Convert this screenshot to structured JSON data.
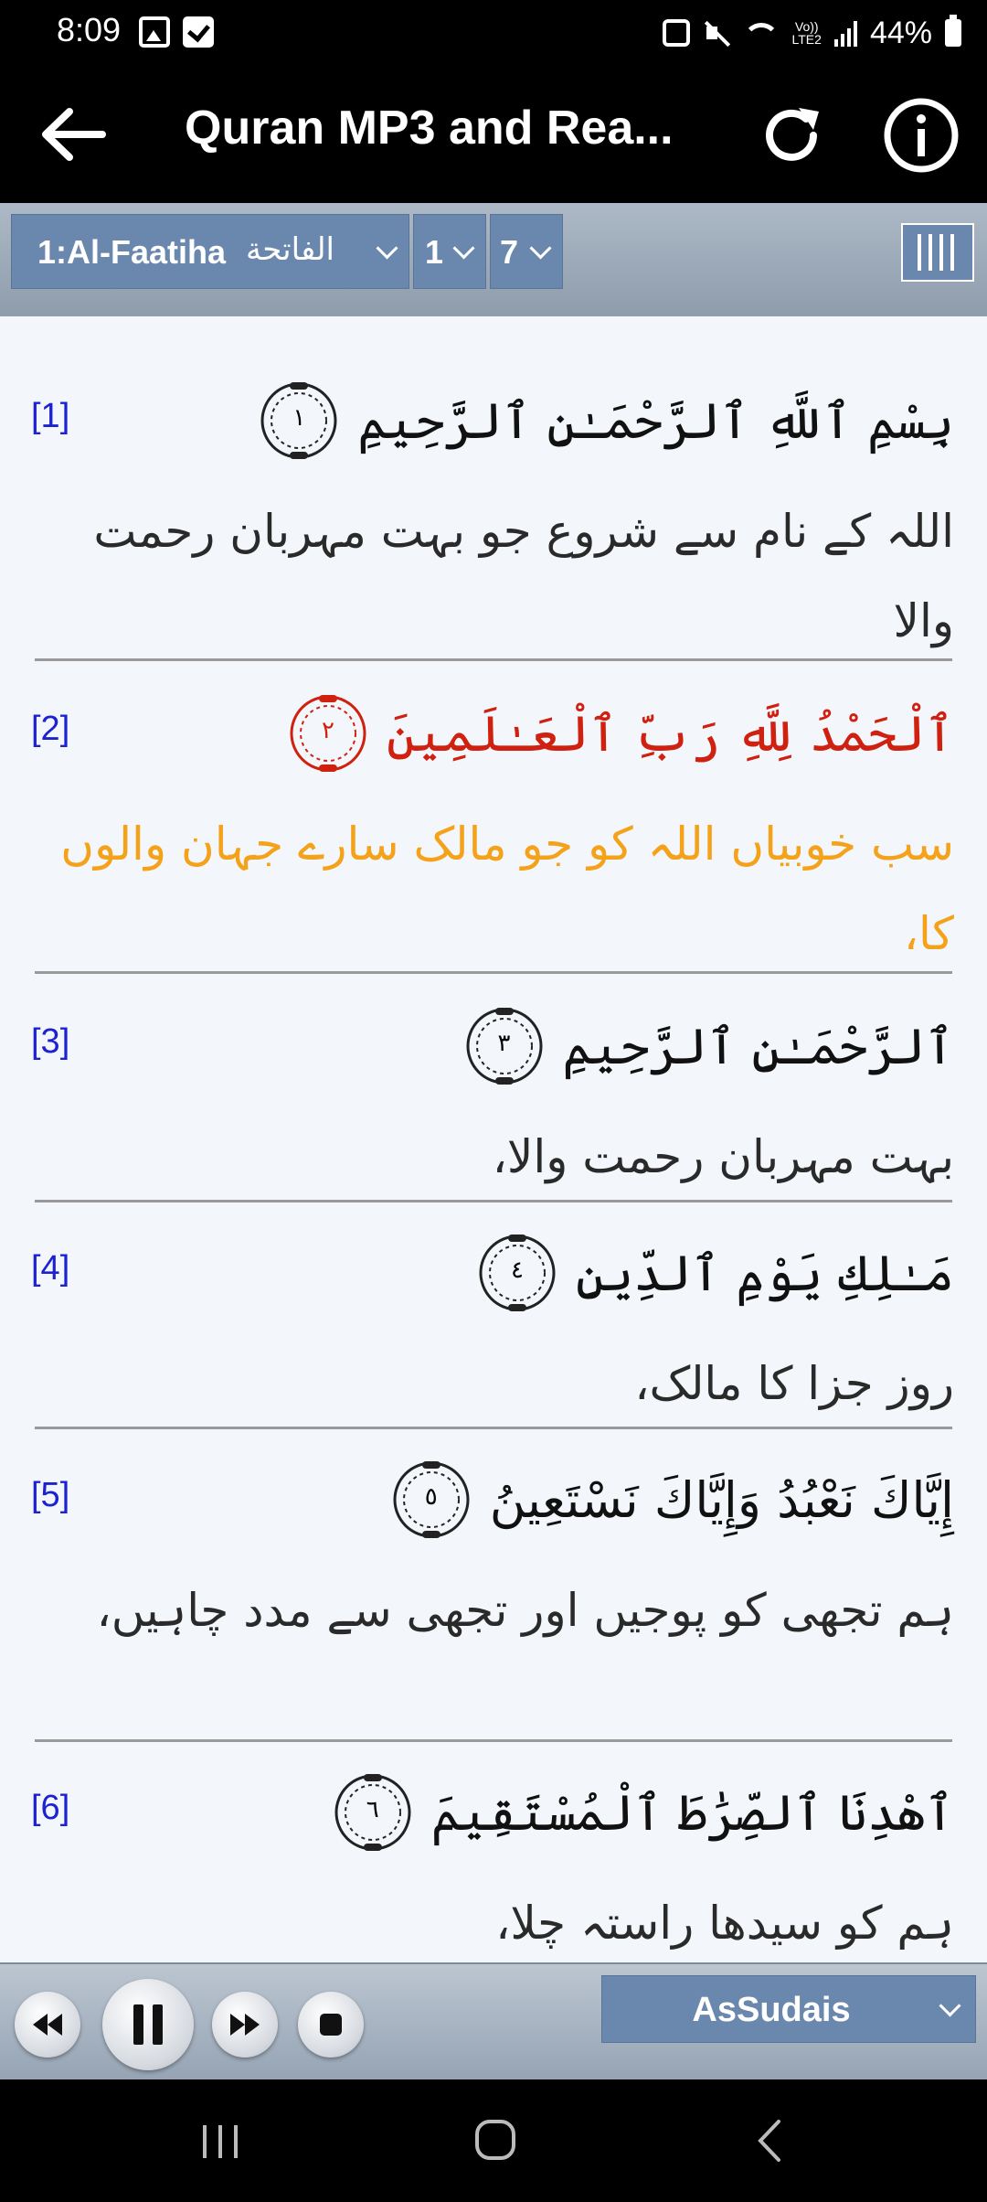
{
  "status_bar": {
    "time": "8:09",
    "volte_line1": "Vo))",
    "volte_line2": "LTE2",
    "battery_percent": "44%"
  },
  "app_bar": {
    "title": "Quran MP3 and Rea..."
  },
  "selectors": {
    "surah_latin": "1:Al-Faatiha",
    "surah_arabic": "الفاتحة",
    "ayah": "1",
    "count": "7"
  },
  "verses": [
    {
      "num": "[1]",
      "marker": "١",
      "arabic": "بِسْمِ ٱللَّهِ ٱلرَّحْمَـٰنِ ٱلرَّحِيمِ",
      "translation": "اللہ کے نام سے شروع جو بہت مہربان رحمت والا"
    },
    {
      "num": "[2]",
      "marker": "٢",
      "arabic": "ٱلْحَمْدُ لِلَّهِ رَبِّ ٱلْعَـٰلَمِينَ",
      "translation": "سب خوبیاں اللہ کو جو مالک سارے جہان والوں کا،"
    },
    {
      "num": "[3]",
      "marker": "٣",
      "arabic": "ٱلرَّحْمَـٰنِ ٱلرَّحِيمِ",
      "translation": "بہت مہربان رحمت والا،"
    },
    {
      "num": "[4]",
      "marker": "٤",
      "arabic": "مَـٰلِكِ يَوْمِ ٱلدِّينِ",
      "translation": "روز جزا کا مالک،"
    },
    {
      "num": "[5]",
      "marker": "٥",
      "arabic": "إِيَّاكَ نَعْبُدُ وَإِيَّاكَ نَسْتَعِينُ",
      "translation": "ہم تجھی کو پوجیں اور تجھی سے مدد چاہیں،"
    },
    {
      "num": "[6]",
      "marker": "٦",
      "arabic": "ٱهْدِنَا ٱلصِّرَٰطَ ٱلْمُسْتَقِيمَ",
      "translation": "ہم کو سیدھا راستہ چلا،"
    }
  ],
  "player": {
    "reciter": "AsSudais"
  },
  "colors": {
    "accent": "#6a87ad",
    "active_arabic": "#d02010",
    "active_translation": "#f4a21a",
    "verse_number": "#1c22d0"
  }
}
